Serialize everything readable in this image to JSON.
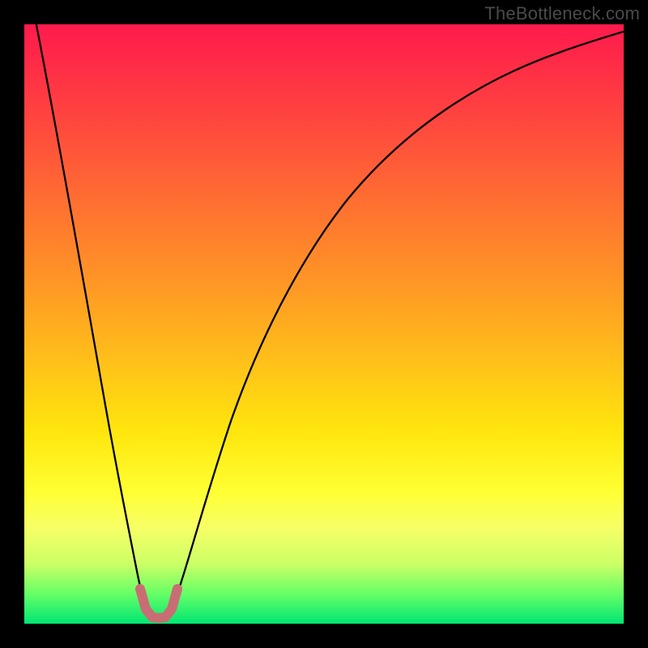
{
  "watermark": {
    "text": "TheBottleneck.com"
  },
  "colors": {
    "background": "#000000",
    "curve_stroke": "#000000",
    "marker_stroke": "#c96d74",
    "gradient_top": "#ff1a4d",
    "gradient_bottom": "#00e673"
  },
  "chart_data": {
    "type": "line",
    "title": "",
    "xlabel": "",
    "ylabel": "",
    "xlim": [
      0,
      100
    ],
    "ylim": [
      0,
      100
    ],
    "grid": false,
    "series": [
      {
        "name": "bottleneck-curve",
        "x": [
          2,
          4,
          6,
          8,
          10,
          12,
          14,
          16,
          18,
          19,
          20,
          21,
          22,
          23,
          24,
          25,
          26,
          28,
          30,
          34,
          38,
          44,
          50,
          58,
          66,
          74,
          82,
          90,
          100
        ],
        "y": [
          100,
          88,
          76,
          64,
          52,
          40,
          30,
          20,
          10,
          6,
          3,
          1,
          0.5,
          1,
          3,
          6,
          10,
          18,
          26,
          40,
          50,
          60,
          67,
          73,
          77,
          80,
          82.5,
          84.5,
          86.5
        ]
      },
      {
        "name": "optimal-marker",
        "x": [
          19.2,
          20,
          21,
          22,
          23,
          24,
          24.8
        ],
        "y": [
          5.5,
          2.5,
          1,
          0.7,
          1,
          2.5,
          5.5
        ]
      }
    ]
  }
}
